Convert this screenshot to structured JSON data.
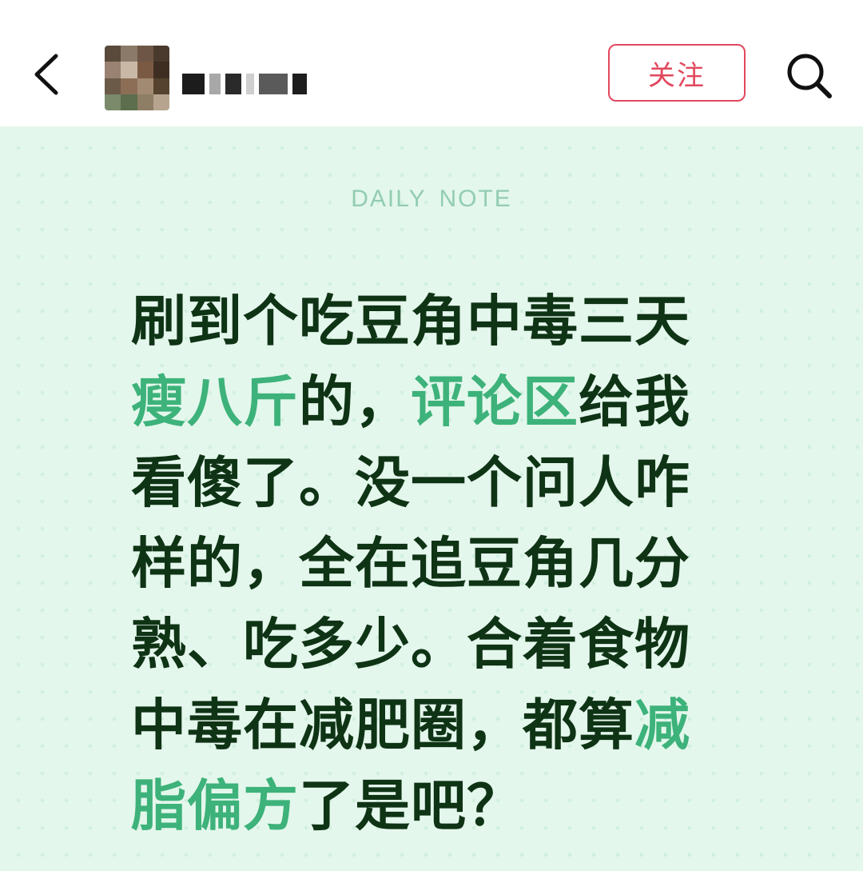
{
  "header": {
    "follow_label": "关注",
    "icons": {
      "back": "chevron-left-icon",
      "search": "search-icon"
    },
    "colors": {
      "follow_accent": "#e2485e"
    }
  },
  "note": {
    "label": "DAILY NOTE",
    "segments": [
      {
        "text": "刷到个吃豆角中毒三天",
        "highlight": false
      },
      {
        "text": "瘦八斤",
        "highlight": true
      },
      {
        "text": "的，",
        "highlight": false
      },
      {
        "text": "评论区",
        "highlight": true
      },
      {
        "text": "给我看傻了。没一个问人咋样的，全在追豆角几分熟、吃多少。合着食物中毒在减肥圈，都算",
        "highlight": false
      },
      {
        "text": "减脂偏方",
        "highlight": true
      },
      {
        "text": "了是吧？",
        "highlight": false
      }
    ],
    "colors": {
      "background": "#e4f7ec",
      "text": "#0f3315",
      "highlight": "#3db27a",
      "label": "#92cdb2"
    }
  }
}
